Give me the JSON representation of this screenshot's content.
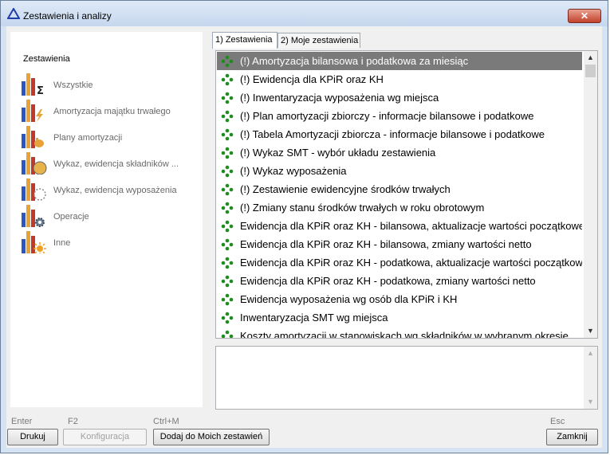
{
  "window": {
    "title": "Zestawienia i analizy",
    "close_glyph": "✕"
  },
  "sidebar": {
    "header": "Zestawienia",
    "items": [
      {
        "label": "Wszystkie",
        "icon": "sigma-icon"
      },
      {
        "label": "Amortyzacja majątku trwałego",
        "icon": "lightning-icon"
      },
      {
        "label": "Plany amortyzacji",
        "icon": "hand-icon"
      },
      {
        "label": "Wykaz, ewidencja składników ...",
        "icon": "circle-icon"
      },
      {
        "label": "Wykaz, ewidencja wyposażenia",
        "icon": "dashed-circle-icon"
      },
      {
        "label": "Operacje",
        "icon": "gear-icon"
      },
      {
        "label": "Inne",
        "icon": "sun-icon"
      }
    ]
  },
  "tabs": [
    {
      "label": "1) Zestawienia",
      "active": true
    },
    {
      "label": "2) Moje zestawienia",
      "active": false
    }
  ],
  "list": {
    "selected_index": 0,
    "items": [
      "(!) Amortyzacja bilansowa i podatkowa za miesiąc",
      "(!) Ewidencja dla KPiR oraz KH",
      "(!) Inwentaryzacja wyposażenia wg miejsca",
      "(!) Plan amortyzacji zbiorczy - informacje bilansowe i podatkowe",
      "(!) Tabela Amortyzacji zbiorcza - informacje bilansowe i podatkowe",
      "(!) Wykaz SMT - wybór układu zestawienia",
      "(!) Wykaz wyposażenia",
      "(!) Zestawienie ewidencyjne środków trwałych",
      "(!) Zmiany stanu środków trwałych w roku obrotowym",
      "Ewidencja dla KPiR oraz KH - bilansowa, aktualizacje wartości początkowej",
      "Ewidencja dla KPiR oraz KH - bilansowa, zmiany wartości netto",
      "Ewidencja dla KPiR oraz KH - podatkowa, aktualizacje wartości początkowej",
      "Ewidencja dla KPiR oraz KH - podatkowa, zmiany wartości netto",
      "Ewidencja wyposażenia wg osób dla KPiR i KH",
      "Inwentaryzacja SMT wg miejsca",
      "Koszty amortyzacji w stanowiskach wg składników w wybranym okresie"
    ]
  },
  "footer": {
    "buttons": [
      {
        "name": "print-button",
        "hotkey": "Enter",
        "label": "Drukuj",
        "enabled": true
      },
      {
        "name": "config-button",
        "hotkey": "F2",
        "label": "Konfiguracja",
        "enabled": false
      },
      {
        "name": "add-to-my-button",
        "hotkey": "Ctrl+M",
        "label": "Dodaj do Moich zestawień",
        "enabled": true
      },
      {
        "name": "close-button",
        "hotkey": "Esc",
        "label": "Zamknij",
        "enabled": true
      }
    ]
  },
  "colors": {
    "selection": "#7a7a7a",
    "dot_green": "#1e8c1e",
    "bar_blue": "#2b57c4",
    "bar_red": "#c0392b",
    "bar_orange": "#e8a23a"
  }
}
